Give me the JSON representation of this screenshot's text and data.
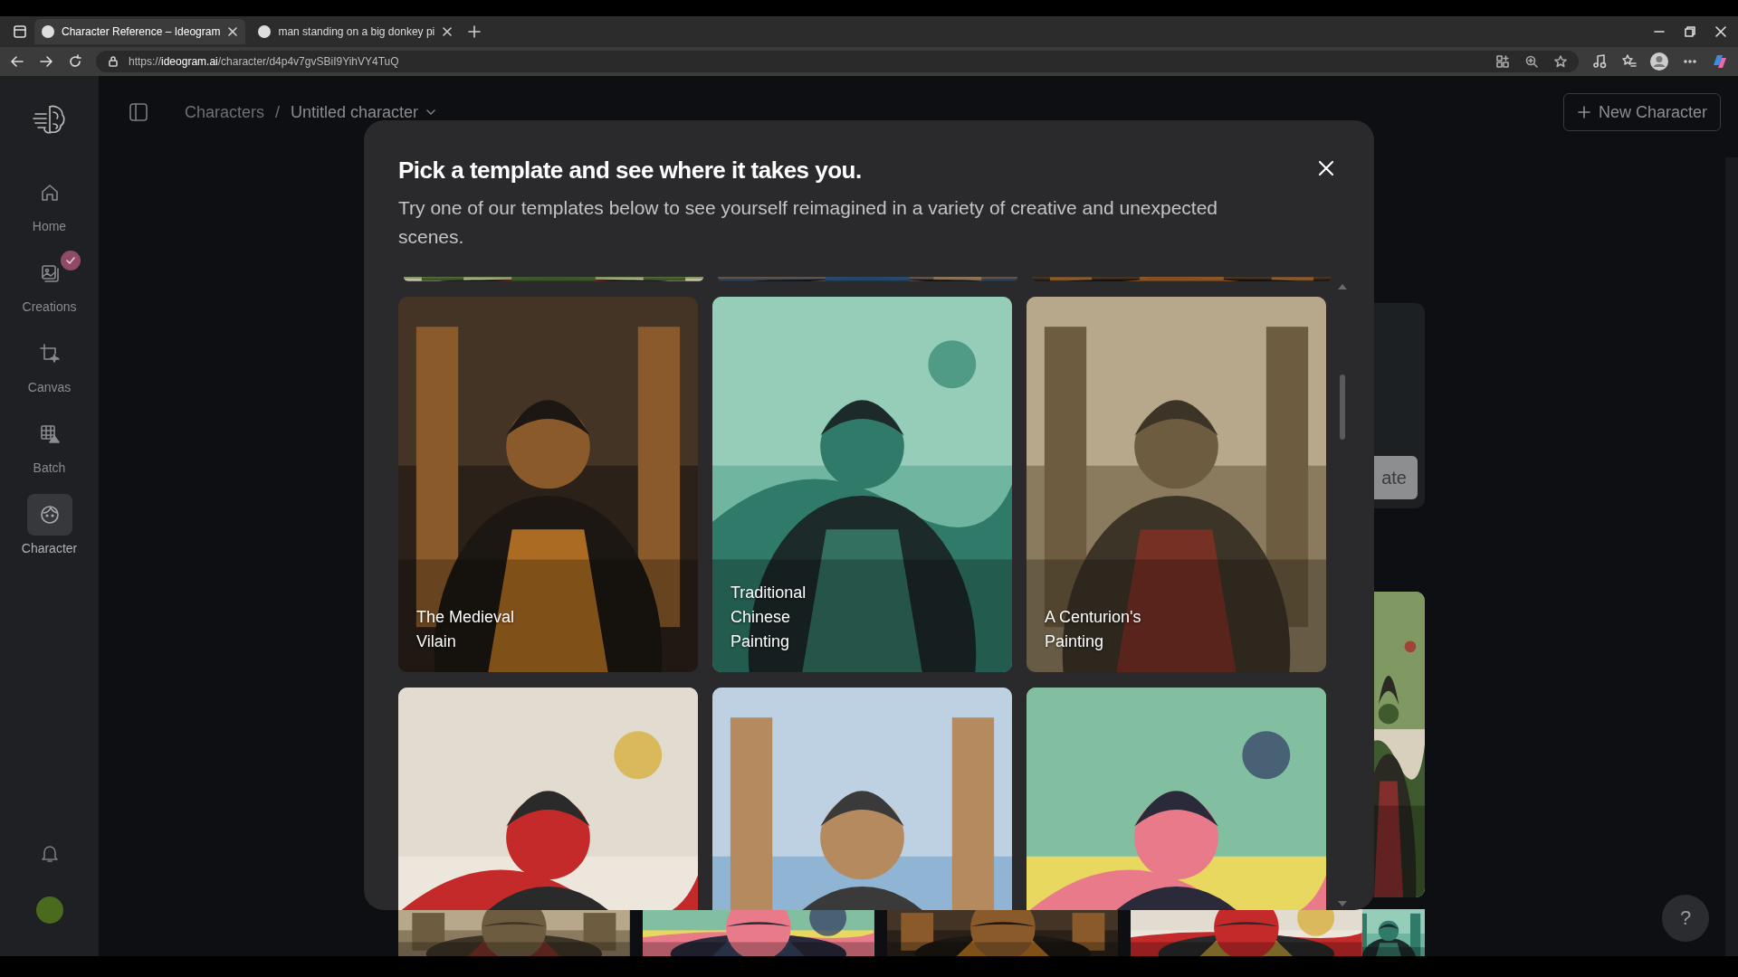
{
  "browser": {
    "tabs": [
      {
        "title": "Character Reference – Ideogram",
        "selected": true
      },
      {
        "title": "man standing on a big donkey pi",
        "selected": false
      }
    ],
    "url": {
      "scheme": "https://",
      "domain": "ideogram.ai",
      "path": "/character/d4p4v7gvSBiI9YihVY4TuQ"
    }
  },
  "sidebar": {
    "items": [
      {
        "label": "Home",
        "selected": false,
        "badge": false
      },
      {
        "label": "Creations",
        "selected": false,
        "badge": true
      },
      {
        "label": "Canvas",
        "selected": false,
        "badge": false
      },
      {
        "label": "Batch",
        "selected": false,
        "badge": false
      },
      {
        "label": "Character",
        "selected": true,
        "badge": false
      }
    ]
  },
  "header": {
    "breadcrumb": {
      "items": [
        "Characters",
        "Untitled character"
      ],
      "separator": "/"
    },
    "new_button": "New Character"
  },
  "behind": {
    "button": "ate"
  },
  "help_button": "?",
  "modal": {
    "title": "Pick a template and see where it takes you.",
    "subtitle": "Try one of our templates below to see yourself reimagined in a variety of creative and unexpected scenes.",
    "templates": [
      {
        "kind": "picture",
        "label": "The Medieval Vilain"
      },
      {
        "kind": "picture",
        "label": "Traditional Chinese Painting"
      },
      {
        "kind": "picture",
        "label": "A Centurion's Painting"
      },
      {
        "kind": "picture"
      },
      {
        "kind": "picture"
      },
      {
        "kind": "picture"
      }
    ]
  }
}
